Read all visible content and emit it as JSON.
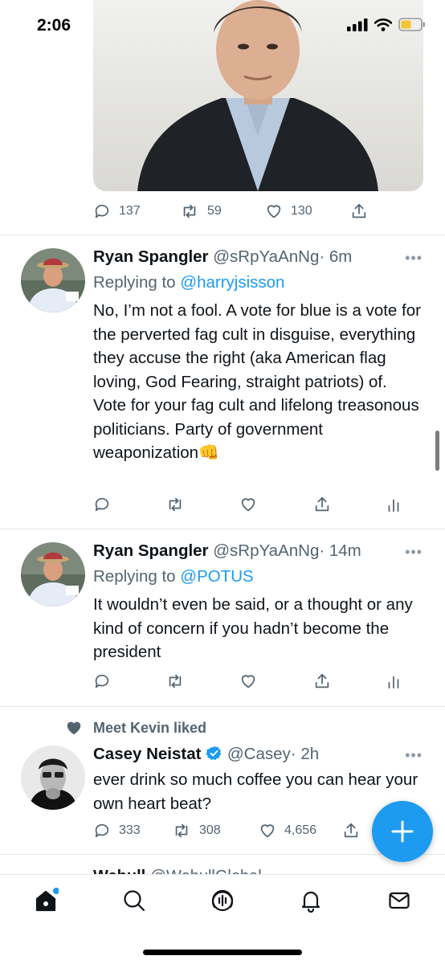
{
  "status_bar": {
    "time": "2:06"
  },
  "top_tweet_actions": {
    "replies": "137",
    "retweets": "59",
    "likes": "130"
  },
  "tweets": [
    {
      "name": "Ryan Spangler",
      "handle": "@sRpYaAnNg",
      "time": "· 6m",
      "replying_label": "Replying to ",
      "replying_to": "@harryjsisson",
      "text": "No, I’m not a fool. A vote for blue is a vote for the perverted fag cult in disguise, everything they accuse the right (aka American flag loving, God Fearing, straight patriots) of.  Vote for your fag cult and lifelong treasonous politicians. Party of government weaponization👊"
    },
    {
      "name": "Ryan Spangler",
      "handle": "@sRpYaAnNg",
      "time": "· 14m",
      "replying_label": "Replying to ",
      "replying_to": "@POTUS",
      "text": "It wouldn’t even be said, or a thought or any kind of concern if you hadn’t become the president"
    },
    {
      "social_context": "Meet Kevin liked",
      "name": "Casey Neistat",
      "verified": true,
      "handle": "@Casey",
      "time": "· 2h",
      "text": "ever drink so much coffee you can hear your own heart beat?",
      "replies": "333",
      "retweets": "308",
      "likes": "4,656"
    }
  ],
  "peek_tweet": {
    "name": "Webull",
    "handle": "@WebullGlobal"
  },
  "colors": {
    "accent": "#1d9bf0",
    "muted": "#536471",
    "text": "#0f1419"
  },
  "tabs": [
    "home-icon",
    "search-icon",
    "spaces-icon",
    "notifications-icon",
    "messages-icon"
  ]
}
